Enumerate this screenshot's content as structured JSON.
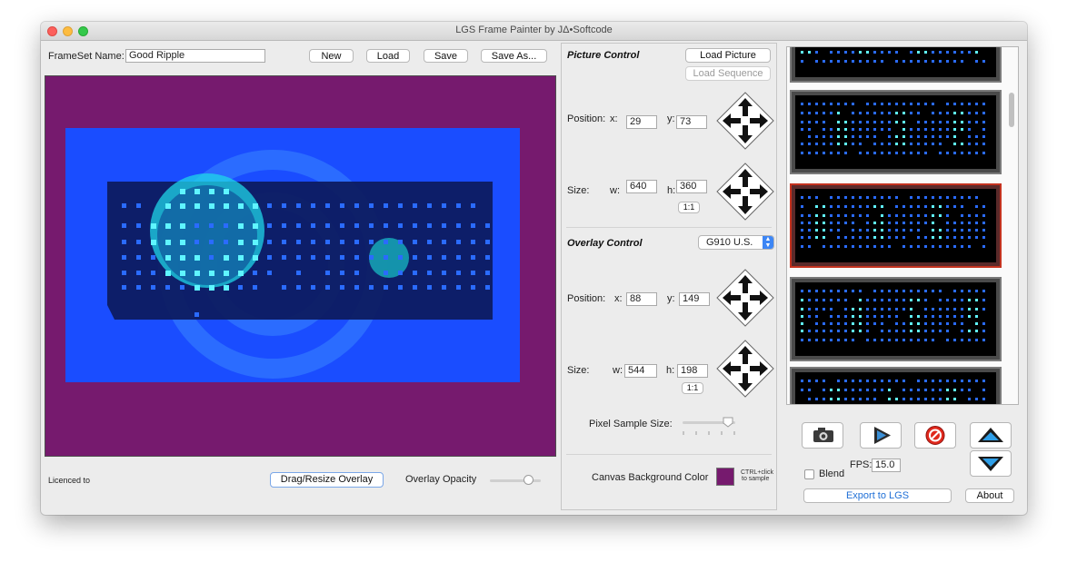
{
  "window": {
    "title": "LGS Frame Painter by JΔ•Softcode"
  },
  "top_bar": {
    "frameset_label": "FrameSet Name:",
    "frameset_value": "Good Ripple",
    "new_label": "New",
    "load_label": "Load",
    "save_label": "Save",
    "save_as_label": "Save As..."
  },
  "canvas": {
    "background_color": "#761a6e",
    "picture_color": "#1a4dff",
    "keyboard_color": "#0c1a5c"
  },
  "bottom_left": {
    "licence_label": "Licenced to",
    "drag_resize_label": "Drag/Resize Overlay",
    "overlay_opacity_label": "Overlay Opacity",
    "overlay_opacity_level": 0.8
  },
  "picture_control": {
    "title": "Picture Control",
    "load_picture_label": "Load Picture",
    "load_sequence_label": "Load Sequence",
    "position_label": "Position:",
    "x_label": "x:",
    "x_value": "29",
    "y_label": "y:",
    "y_value": "73",
    "size_label": "Size:",
    "w_label": "w:",
    "w_value": "640",
    "h_label": "h:",
    "h_value": "360",
    "ratio_label": "1:1"
  },
  "overlay_control": {
    "title": "Overlay Control",
    "keyboard_value": "G910 U.S.",
    "position_label": "Position:",
    "x_label": "x:",
    "x_value": "88",
    "y_label": "y:",
    "y_value": "149",
    "size_label": "Size:",
    "w_label": "w:",
    "w_value": "544",
    "h_label": "h:",
    "h_value": "198",
    "ratio_label": "1:1",
    "pixel_sample_label": "Pixel Sample Size:",
    "pixel_sample_level": 0.9
  },
  "canvas_bg": {
    "label": "Canvas Background Color",
    "color": "#761a6e",
    "hint_line1": "CTRL+click",
    "hint_line2": "to sample"
  },
  "playback": {
    "camera_icon": "camera-icon",
    "play_icon": "play-icon",
    "stop_icon": "no-entry-icon",
    "up_icon": "arrow-up-icon",
    "down_icon": "arrow-down-icon",
    "blend_label": "Blend",
    "blend_checked": false,
    "fps_label": "FPS:",
    "fps_value": "15.0",
    "export_label": "Export to LGS",
    "about_label": "About"
  },
  "frames": {
    "count_visible": 5,
    "selected_index": 2
  }
}
